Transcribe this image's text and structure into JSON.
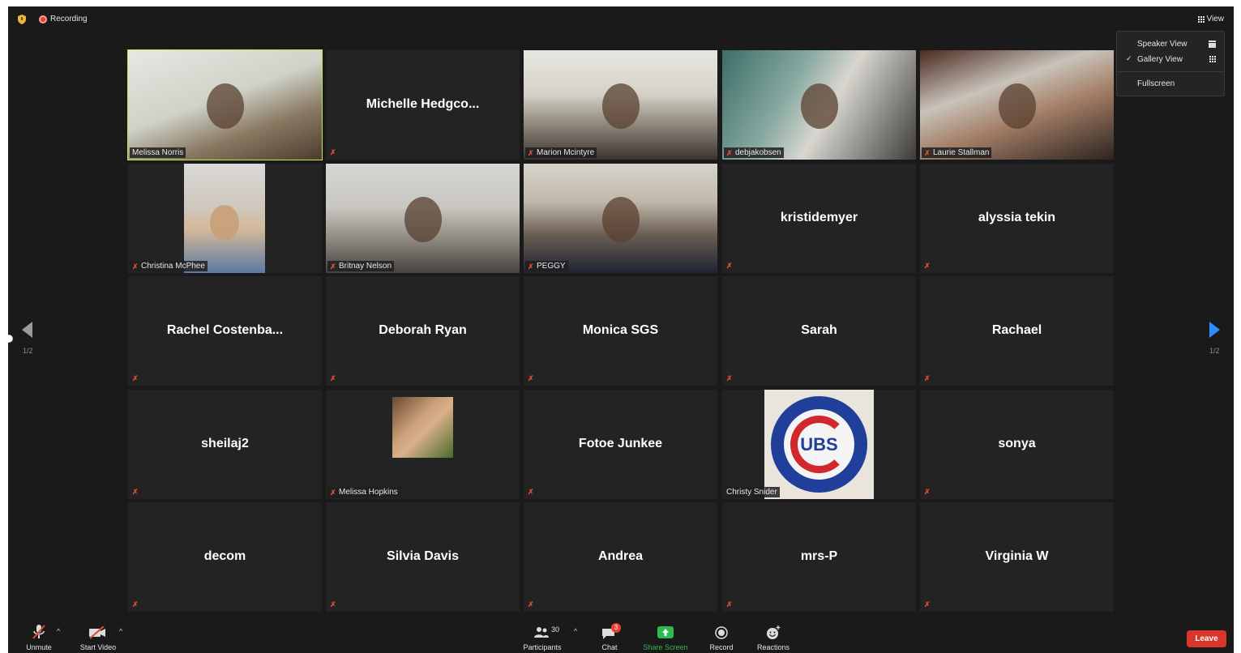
{
  "topbar": {
    "recording_label": "Recording",
    "view_label": "View"
  },
  "view_menu": {
    "speaker_view": "Speaker View",
    "gallery_view": "Gallery View",
    "gallery_check": "✓",
    "fullscreen": "Fullscreen"
  },
  "nav": {
    "page_left": "1/2",
    "page_right": "1/2"
  },
  "tiles": [
    {
      "name": "Melissa Norris",
      "kind": "video",
      "muted": false
    },
    {
      "name": "Michelle  Hedgco...",
      "kind": "name",
      "muted": true
    },
    {
      "name": "Marion Mcintyre",
      "kind": "video",
      "muted": true
    },
    {
      "name": "debjakobsen",
      "kind": "video",
      "muted": true
    },
    {
      "name": "Laurie Stallman",
      "kind": "video",
      "muted": true
    },
    {
      "name": "Christina McPhee",
      "kind": "video",
      "muted": true
    },
    {
      "name": "Britnay Nelson",
      "kind": "video",
      "muted": true
    },
    {
      "name": "PEGGY",
      "kind": "video",
      "muted": true
    },
    {
      "name": "kristidemyer",
      "kind": "name",
      "muted": true
    },
    {
      "name": "alyssia tekin",
      "kind": "name",
      "muted": true
    },
    {
      "name": "Rachel  Costenba...",
      "kind": "name",
      "muted": true
    },
    {
      "name": "Deborah Ryan",
      "kind": "name",
      "muted": true
    },
    {
      "name": "Monica SGS",
      "kind": "name",
      "muted": true
    },
    {
      "name": "Sarah",
      "kind": "name",
      "muted": true
    },
    {
      "name": "Rachael",
      "kind": "name",
      "muted": true
    },
    {
      "name": "sheilaj2",
      "kind": "name",
      "muted": true
    },
    {
      "name": "Melissa Hopkins",
      "kind": "photo",
      "muted": true
    },
    {
      "name": "Fotoe Junkee",
      "kind": "name",
      "muted": true
    },
    {
      "name": "Christy Snider",
      "kind": "logo",
      "muted": false,
      "logo_text": "UBS"
    },
    {
      "name": "sonya",
      "kind": "name",
      "muted": true
    },
    {
      "name": "decom",
      "kind": "name",
      "muted": true
    },
    {
      "name": "Silvia Davis",
      "kind": "name",
      "muted": true
    },
    {
      "name": "Andrea",
      "kind": "name",
      "muted": true
    },
    {
      "name": "mrs-P",
      "kind": "name",
      "muted": true
    },
    {
      "name": "Virginia W",
      "kind": "name",
      "muted": true
    }
  ],
  "toolbar": {
    "unmute": "Unmute",
    "start_video": "Start Video",
    "participants": "Participants",
    "participants_count": "30",
    "chat": "Chat",
    "chat_badge": "3",
    "share_screen": "Share Screen",
    "record": "Record",
    "reactions": "Reactions",
    "leave": "Leave"
  },
  "colors": {
    "speaking_border": "#c3e84a",
    "share_green": "#2dbb4d",
    "leave_red": "#d9352a",
    "nav_blue": "#2d8cff",
    "mic_muted_red": "#e04a3a"
  }
}
